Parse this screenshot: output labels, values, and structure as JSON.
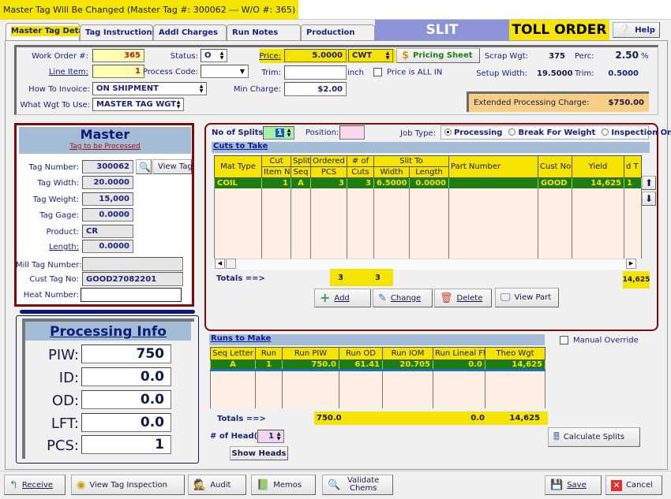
{
  "window": {
    "title": "Master Tag Will Be Changed  (Master Tag #: 300062 --- W/O #: 365)"
  },
  "tabs": [
    {
      "label": "Master Tag Details",
      "active": true
    },
    {
      "label": "Tag Instructions"
    },
    {
      "label": "Addl Charges"
    },
    {
      "label": "Run Notes"
    },
    {
      "label": "Production"
    }
  ],
  "banner": {
    "job_type": "SLIT",
    "order_type": "TOLL ORDER"
  },
  "help": {
    "label": "Help",
    "icon": "help-icon"
  },
  "header_form": {
    "work_order_label": "Work Order #:",
    "work_order": "365",
    "line_item_label": "Line Item:",
    "line_item": "1",
    "status_label": "Status:",
    "status": "O",
    "process_code_label": "Process Code:",
    "process_code": "",
    "how_to_invoice_label": "How To Invoice:",
    "how_to_invoice": "ON SHIPMENT",
    "what_wgt_label": "What Wgt To Use:",
    "what_wgt": "MASTER TAG WGT",
    "price_label": "Price:",
    "price": "5.0000",
    "price_unit": "CWT",
    "pricing_sheet_label": "Pricing Sheet",
    "trim_label": "Trim:",
    "trim": "",
    "trim_unit": "inch",
    "price_all_in_label": "Price is ALL IN",
    "price_all_in": false,
    "min_charge_label": "Min Charge:",
    "min_charge": "$2.00",
    "scrap_wgt_label": "Scrap Wgt:",
    "scrap_wgt": "375",
    "perc_label": "Perc:",
    "perc": "2.50",
    "perc_unit": "%",
    "setup_width_label": "Setup Width:",
    "setup_width": "19.5000",
    "trim2_label": "Trim:",
    "trim2": "0.5000",
    "ext_charge_label": "Extended Processing Charge:",
    "ext_charge": "$750.00"
  },
  "master": {
    "title": "Master",
    "subtitle": "Tag to be Processed",
    "fields": {
      "tag_number_label": "Tag Number:",
      "tag_number": "300062",
      "view_tag_label": "View Tag",
      "tag_width_label": "Tag Width:",
      "tag_width": "20.0000",
      "tag_weight_label": "Tag Weight:",
      "tag_weight": "15,000",
      "tag_gage_label": "Tag Gage:",
      "tag_gage": "0.0000",
      "product_label": "Product:",
      "product": "CR",
      "length_label": "Length:",
      "length": "0.0000",
      "mill_tag_label": "Mill Tag Number:",
      "mill_tag": "",
      "cust_tag_label": "Cust Tag No:",
      "cust_tag": "GOOD27082201",
      "heat_number_label": "Heat Number:",
      "heat_number": ""
    }
  },
  "processing_info": {
    "title": "Processing Info",
    "rows": [
      {
        "label": "PIW:",
        "value": "750"
      },
      {
        "label": "ID:",
        "value": "0.0"
      },
      {
        "label": "OD:",
        "value": "0.0"
      },
      {
        "label": "LFT:",
        "value": "0.0"
      },
      {
        "label": "PCS:",
        "value": "1"
      }
    ]
  },
  "cuts": {
    "no_splits_label": "No of Splits:",
    "no_splits": "1",
    "position_label": "Position:",
    "position": "",
    "job_type_label": "Job Type:",
    "job_type_options": [
      "Processing",
      "Break For Weight",
      "Inspection Only"
    ],
    "job_type_selected": "Processing",
    "section_title": "Cuts to Take",
    "columns_top": [
      "Mat Type",
      "Cut",
      "Split",
      "Ordered",
      "# of",
      "Slit To",
      "Part Number",
      "Cust No",
      "Yield",
      "d T"
    ],
    "columns_bottom": [
      "Item N",
      "Seq",
      "PCS",
      "Cuts",
      "Width",
      "Length"
    ],
    "rows": [
      {
        "mat_type": "COIL",
        "cut_item": "1",
        "split_seq": "A",
        "ordered_pcs": "3",
        "num_cuts": "3",
        "width": "6.5000",
        "length": "0.0000",
        "part_number": "",
        "cust_no": "GOOD",
        "yield": "14,625",
        "dt": "1"
      }
    ],
    "totals_label": "Totals ==>",
    "total_pcs": "3",
    "total_cuts": "3",
    "total_yield": "14,625",
    "buttons": {
      "add": "Add",
      "change": "Change",
      "delete": "Delete",
      "view_part": "View Part"
    }
  },
  "runs": {
    "section_title": "Runs to Make",
    "manual_override_label": "Manual Override",
    "manual_override": false,
    "columns": [
      "Seq Letter",
      "Run",
      "Run PIW",
      "Run OD",
      "Run IOM",
      "Run Lineal Ft",
      "Theo Wgt"
    ],
    "rows": [
      {
        "seq": "A",
        "run": "1",
        "piw": "750.0",
        "od": "61.41",
        "iom": "20.705",
        "lineal_ft": "0.0",
        "theo_wgt": "14,625"
      }
    ],
    "totals_label": "Totals ==>",
    "total_piw": "750.0",
    "total_lineal": "0.0",
    "total_theo": "14,625",
    "heads_label": "# of Head(s):",
    "heads": "1",
    "show_heads_label": "Show Heads",
    "calc_splits_label": "Calculate Splits"
  },
  "bottom_buttons": {
    "receive": "Receive",
    "view_tag_inspection": "View Tag Inspection",
    "audit": "Audit",
    "memos": "Memos",
    "validate_chems": "Validate Chems",
    "save": "Save",
    "cancel": "Cancel"
  }
}
